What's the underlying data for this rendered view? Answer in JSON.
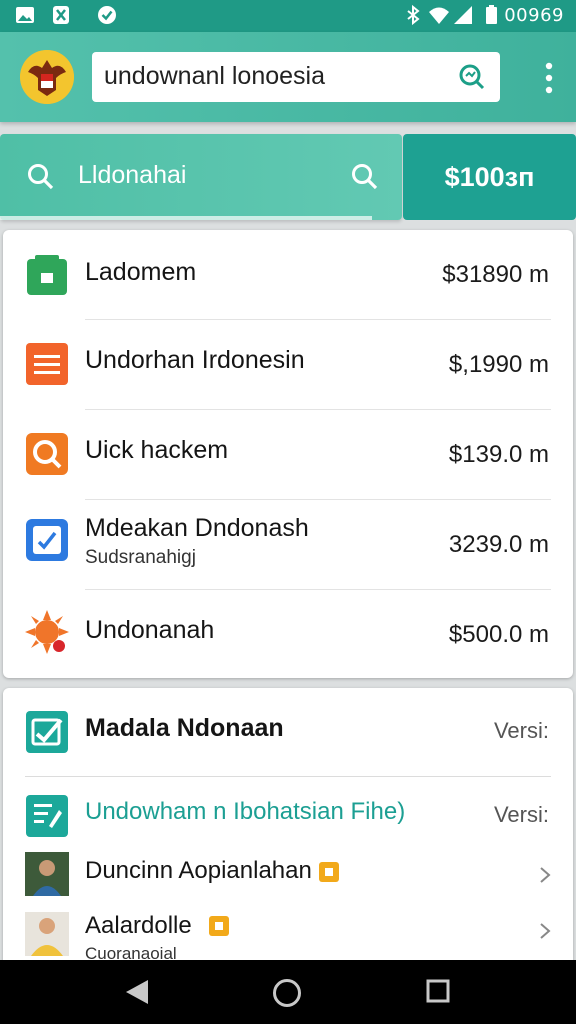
{
  "status_bar": {
    "time": "00969",
    "icons": [
      "image-icon",
      "app-icon",
      "check-icon",
      "bluetooth-icon",
      "wifi-icon",
      "signal-icon",
      "battery-icon"
    ]
  },
  "app_bar": {
    "search_value": "undownanl lonoesia",
    "accent": "#3fb19c"
  },
  "filter": {
    "query": "Lldonahai",
    "price_button": "$100ɜп"
  },
  "list": [
    {
      "title": "Ladomem",
      "price": "$31890 m",
      "icon": "android-bag-icon",
      "color": "#2fa65a"
    },
    {
      "title": "Undorhan Irdonesin",
      "price": "$,1990 m",
      "icon": "list-icon",
      "color": "#f2642b"
    },
    {
      "title": "Uick hackem",
      "price": "$139.0 m",
      "icon": "search-app-icon",
      "color": "#f07a22"
    },
    {
      "title": "Mdeakan Dndonash",
      "subtitle": "Sudsranahigj",
      "price": "3239.0 m",
      "icon": "edit-icon",
      "color": "#2d7ae0"
    },
    {
      "title": "Undonanah",
      "price": "$500.0 m",
      "icon": "sun-icon",
      "color": "#f0752a"
    }
  ],
  "section2": {
    "header": {
      "title": "Madala Ndonaan",
      "version": "Versi:",
      "icon": "check-app-icon"
    },
    "link": {
      "title": "Undowham n Ibohatsian Fihe)",
      "version": "Versi:",
      "icon": "doc-edit-icon",
      "color": "#1c9f93"
    },
    "items": [
      {
        "title": "Duncinn Aopianlahan",
        "icon": "photo-thumb-icon"
      },
      {
        "title": "Aalardolle",
        "subtitle": "Cuoranaoial",
        "icon": "photo-thumb-icon"
      }
    ]
  }
}
